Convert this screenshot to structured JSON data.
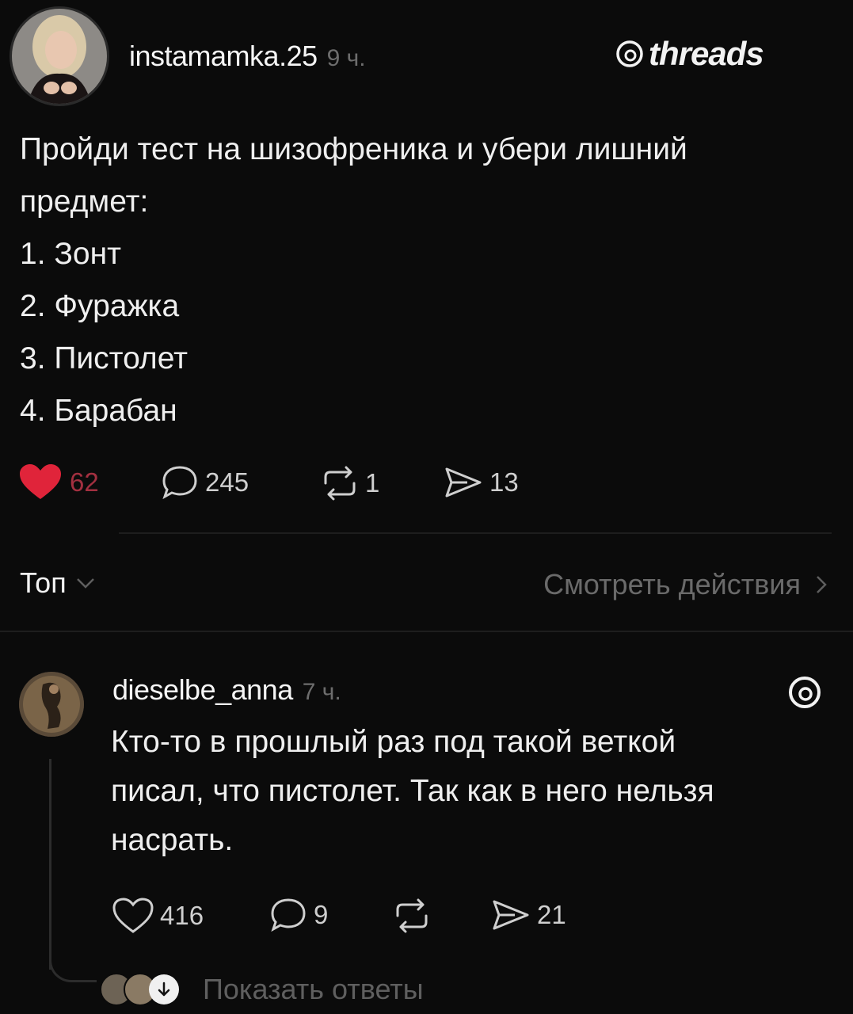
{
  "post": {
    "username": "instamamka.25",
    "time": "9 ч.",
    "brand": "threads",
    "lines": [
      "Пройди тест на шизофреника и убери лишний",
      "предмет:",
      "1. Зонт",
      "2. Фуражка",
      "3. Пистолет",
      "4. Барабан"
    ],
    "stats": {
      "likes": "62",
      "comments": "245",
      "reposts": "1",
      "shares": "13"
    },
    "like_color": "#e0243a"
  },
  "bar": {
    "sort_label": "Топ",
    "activity_label": "Смотреть действия"
  },
  "reply": {
    "username": "dieselbe_anna",
    "time": "7 ч.",
    "lines": [
      "Кто-то в прошлый раз под такой веткой",
      "писал, что пистолет. Так как в него нельзя",
      "насрать."
    ],
    "stats": {
      "likes": "416",
      "comments": "9",
      "shares": "21"
    },
    "show_replies": "Показать ответы"
  }
}
